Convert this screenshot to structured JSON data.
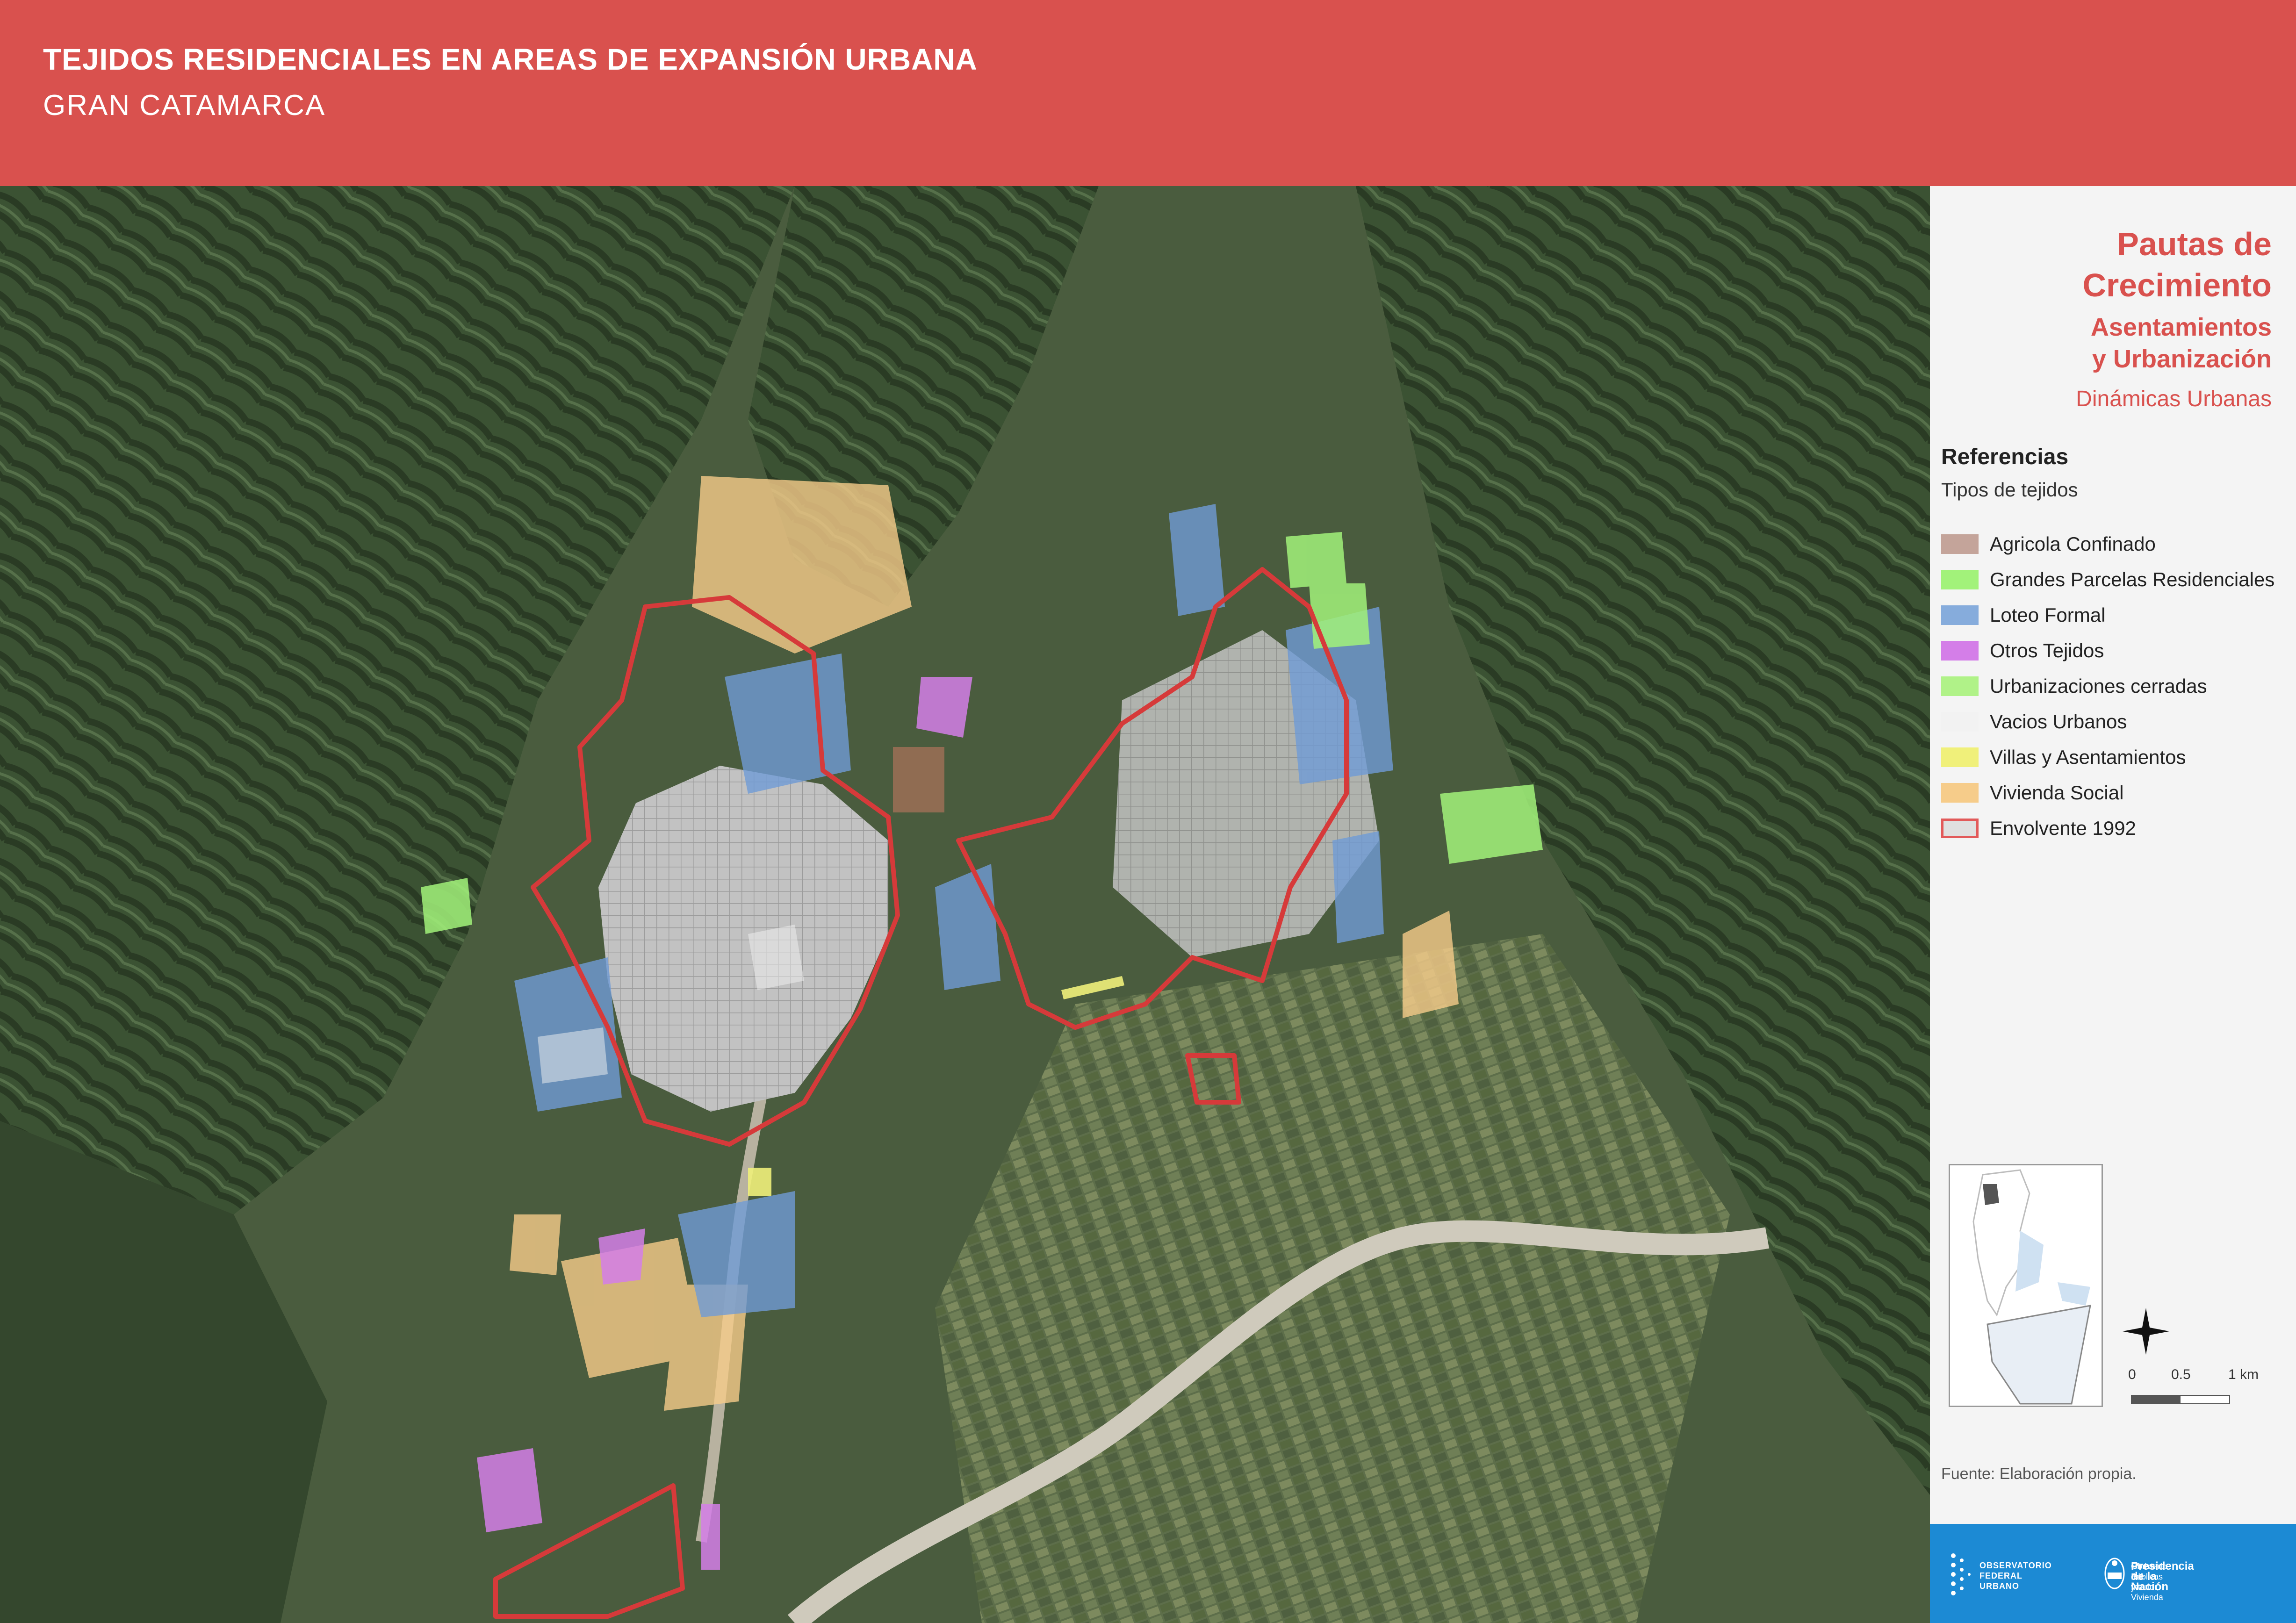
{
  "header": {
    "title": "TEJIDOS RESIDENCIALES EN AREAS DE EXPANSIÓN URBANA",
    "subtitle": "GRAN CATAMARCA",
    "color": "#d9514e"
  },
  "sidebar": {
    "heading": [
      "Pautas de",
      "Crecimiento"
    ],
    "subheading": [
      "Asentamientos",
      "y Urbanización"
    ],
    "section": "Dinámicas Urbanas",
    "references_title": "Referencias",
    "references_subtitle": "Tipos de tejidos",
    "legend": [
      {
        "label": "Agricola Confinado",
        "color": "#c4a49a"
      },
      {
        "label": "Grandes Parcelas Residenciales",
        "color": "#a2f27a"
      },
      {
        "label": "Loteo Formal",
        "color": "#86acdc"
      },
      {
        "label": "Otros Tejidos",
        "color": "#d47ee8"
      },
      {
        "label": "Urbanizaciones cerradas",
        "color": "#b0f288"
      },
      {
        "label": "Vacios Urbanos",
        "color": "#f2f2f2"
      },
      {
        "label": "Villas y Asentamientos",
        "color": "#f0f07a"
      },
      {
        "label": "Vivienda Social",
        "color": "#f6cc8a"
      },
      {
        "label": "Envolvente 1992",
        "color": "#e0e0e0",
        "border": "#e25a5a"
      }
    ],
    "scale": {
      "labels": [
        "0",
        "0.5",
        "1 km"
      ]
    },
    "source": "Fuente: Elaboración propia."
  },
  "footer": {
    "left_logo": [
      "OBSERVATORIO",
      "FEDERAL",
      "URBANO"
    ],
    "right_logo": [
      "Ministerio del Interior,",
      "Obras Públicas y Vivienda",
      "Presidencia de la Nación"
    ],
    "color": "#1c8ad4"
  },
  "map": {
    "terrain_color": "#3e5236",
    "urban_color": "#bdbdbd",
    "envelope_color": "#d63a3a"
  }
}
